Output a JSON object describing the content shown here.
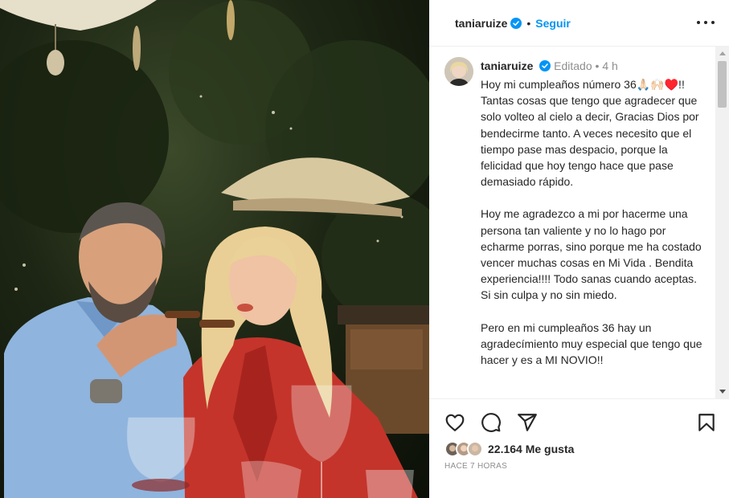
{
  "post": {
    "username": "taniaruize",
    "follow_label": "Seguir",
    "separator": "•"
  },
  "caption": {
    "username": "taniaruize",
    "edited": "Editado",
    "time_ago": "4 h",
    "paragraphs": [
      "Hoy mi cumpleaños número 36🙏🏻🙌🏻♥️!! Tantas cosas que tengo que agradecer que solo volteo al cielo a decir, Gracias Dios por bendecirme tanto. A veces necesito que el tiempo pase mas despacio, porque la felicidad que hoy tengo hace que pase demasiado rápido.",
      "Hoy me agradezco a mi por hacerme una persona tan valiente y no lo hago por echarme porras, sino porque me ha costado vencer muchas cosas en Mi Vida . Bendita experiencia!!!! Todo sanas cuando aceptas. Si sin culpa y no sin miedo.",
      "Pero en mi cumpleaños 36 hay un agradecímiento muy especial que tengo que hacer y es a MI NOVIO!!"
    ]
  },
  "engagement": {
    "likes": "22.164 Me gusta",
    "posted": "HACE 7 HORAS"
  },
  "colors": {
    "link_blue": "#0095f6",
    "verified_blue": "#0095f6",
    "muted": "#8e8e8e"
  },
  "icons": [
    "verified-icon",
    "more-options-icon",
    "heart-icon",
    "comment-icon",
    "share-icon",
    "bookmark-icon"
  ]
}
